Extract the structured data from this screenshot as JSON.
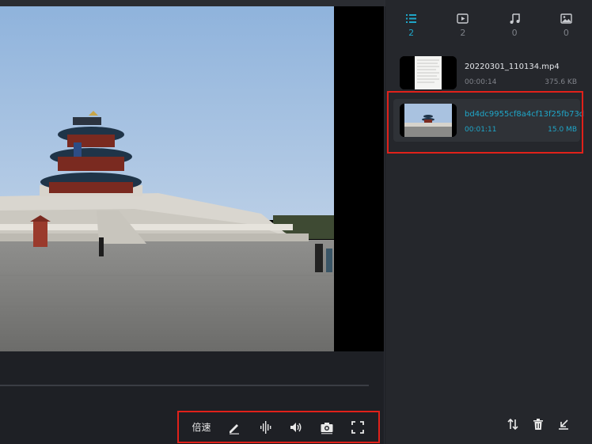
{
  "player": {
    "controls": {
      "speed_label": "倍速"
    }
  },
  "sidebar": {
    "tabs": [
      {
        "icon": "list-icon",
        "count": "2",
        "active": true
      },
      {
        "icon": "video-icon",
        "count": "2",
        "active": false
      },
      {
        "icon": "music-icon",
        "count": "0",
        "active": false
      },
      {
        "icon": "image-icon",
        "count": "0",
        "active": false
      }
    ],
    "files": [
      {
        "name": "20220301_110134.mp4",
        "duration": "00:00:14",
        "size": "375.6 KB",
        "selected": false
      },
      {
        "name": "bd4dc9955cf8a4cf13f25fb73d",
        "duration": "00:01:11",
        "size": "15.0 MB",
        "selected": true
      }
    ]
  },
  "colors": {
    "accent": "#1fa6c8",
    "highlight_border": "#e0211a",
    "background": "#1d1f24"
  }
}
